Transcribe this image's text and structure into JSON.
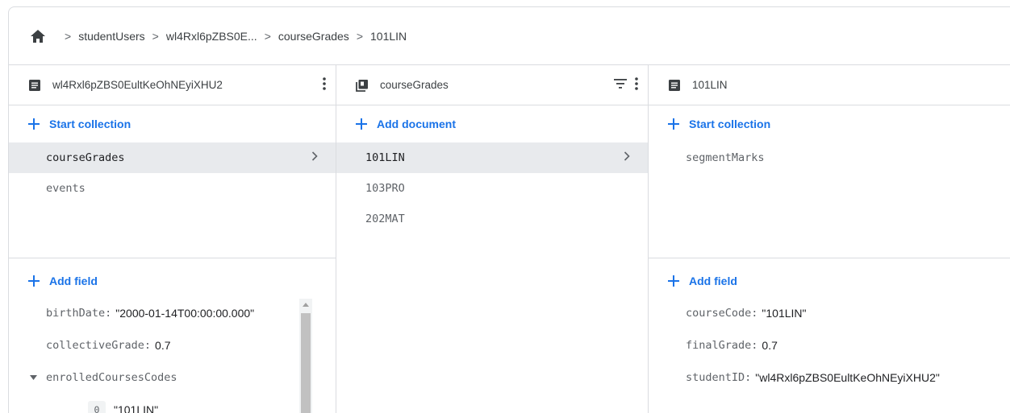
{
  "breadcrumb": {
    "items": [
      "studentUsers",
      "wl4Rxl6pZBS0E...",
      "courseGrades",
      "101LIN"
    ]
  },
  "panel1": {
    "title": "wl4Rxl6pZBS0EultKeOhNEyiXHU2",
    "add_collection": "Start collection",
    "collections": [
      "courseGrades",
      "events"
    ],
    "add_field": "Add field",
    "fields": [
      {
        "key": "birthDate:",
        "value": "\"2000-01-14T00:00:00.000\""
      },
      {
        "key": "collectiveGrade:",
        "value": "0.7"
      },
      {
        "key": "enrolledCoursesCodes",
        "value": ""
      }
    ],
    "array_item": {
      "index": "0",
      "value": "\"101LIN\""
    }
  },
  "panel2": {
    "title": "courseGrades",
    "add_document": "Add document",
    "documents": [
      "101LIN",
      "103PRO",
      "202MAT"
    ]
  },
  "panel3": {
    "title": "101LIN",
    "add_collection": "Start collection",
    "collections": [
      "segmentMarks"
    ],
    "add_field": "Add field",
    "fields": [
      {
        "key": "courseCode:",
        "value": "\"101LIN\""
      },
      {
        "key": "finalGrade:",
        "value": "0.7"
      },
      {
        "key": "studentID:",
        "value": "\"wl4Rxl6pZBS0EultKeOhNEyiXHU2\""
      }
    ]
  },
  "colors": {
    "accent": "#1a73e8",
    "selected_row": "#e8eaed",
    "border": "#dadce0"
  }
}
